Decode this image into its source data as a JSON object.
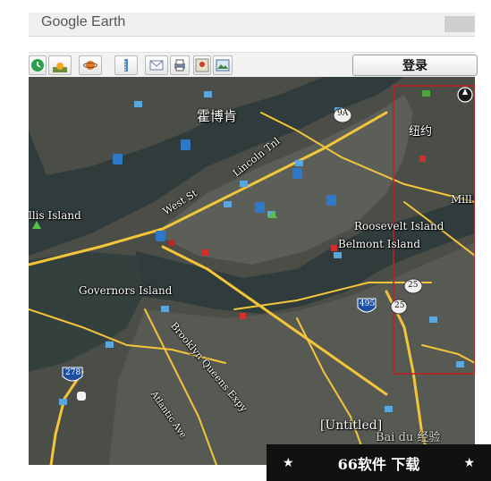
{
  "window": {
    "title": "Google Earth"
  },
  "toolbar": {
    "login_label": "登录",
    "icons": [
      "history-icon",
      "sunlight-icon",
      "planet-icon",
      "ruler-icon",
      "email-icon",
      "print-icon",
      "google-maps-icon",
      "image-icon"
    ]
  },
  "map": {
    "labels": {
      "huoboken": "霍博肯",
      "rt9a": "9A",
      "niuyue": "纽约",
      "mill": "Mill",
      "ellis": "llis Island",
      "west_st": "West St",
      "lincoln": "Lincoln Tnl",
      "roosevelt": "Roosevelt Island",
      "belmont": "Belmont Island",
      "governors": "Governors Island",
      "brooklyn": "Brooklyn Queens Expy",
      "atlantic": "Atlantic Ave",
      "rt25a": "25",
      "rt25b": "25",
      "rt495": "495",
      "rt278": "278",
      "untitled": "[Untitled]",
      "watermark": "Bai du 经验"
    }
  },
  "footer": {
    "text": "66软件 下载",
    "star_left": "★",
    "star_right": "★"
  },
  "colors": {
    "road": "#f3c53a",
    "selection": "#c0201e",
    "water": "#2c3b3a",
    "land": "#4a4d44"
  }
}
